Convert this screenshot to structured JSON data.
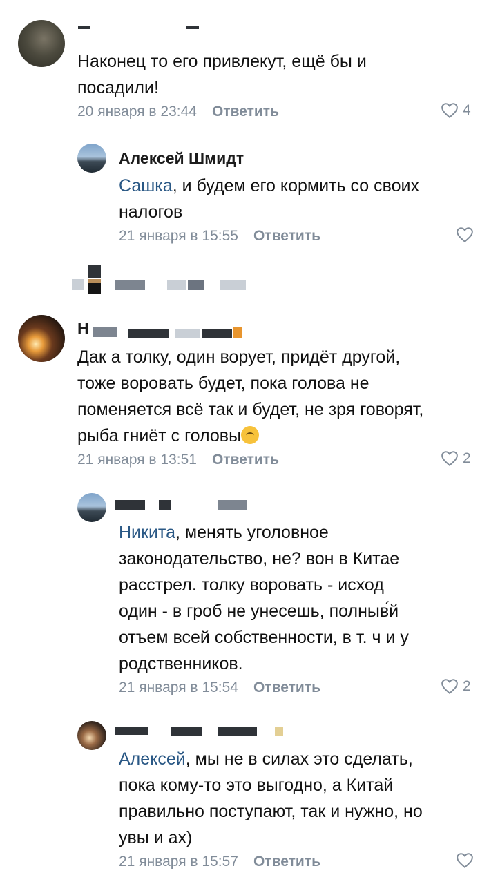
{
  "comments": [
    {
      "text_lines": [
        "Наконец то его привлекут, ещё бы и",
        "посадили!"
      ],
      "date": "20 января в 23:44",
      "reply": "Ответить",
      "likes": "4",
      "heart_icon": "heart-outline-icon"
    },
    {
      "name": "Алексей Шмидт",
      "mention": "Сашка",
      "text_lines": [
        ", и будем его кормить со своих",
        "налогов"
      ],
      "date": "21 января в 15:55",
      "reply": "Ответить",
      "likes": ""
    },
    {
      "name_initial": "Н",
      "text_lines": [
        "Дак а толку, один ворует, придёт другой,",
        "тоже воровать будет, пока голова не",
        "поменяется всё так и будет, не зря говорят,",
        "рыба гниёт с головы"
      ],
      "emoji": "upside-down-face-emoji",
      "date": "21 января в 13:51",
      "reply": "Ответить",
      "likes": "2"
    },
    {
      "mention": "Никита",
      "text_lines": [
        ", менять уголовное",
        "законодательство, не? вон в Китае",
        "расстрел. толку воровать - исход",
        "один - в гроб не унесешь, полныв́й",
        "отъем всей собственности, в т. ч и у",
        "родственников."
      ],
      "date": "21 января в 15:54",
      "reply": "Ответить",
      "likes": "2"
    },
    {
      "mention": "Алексей",
      "text_lines": [
        ", мы не в силах это сделать,",
        "пока кому-то это выгодно, а Китай",
        "правильно поступают, так и нужно, но",
        "увы и ах)"
      ],
      "date": "21 января в 15:57",
      "reply": "Ответить",
      "likes": ""
    }
  ]
}
